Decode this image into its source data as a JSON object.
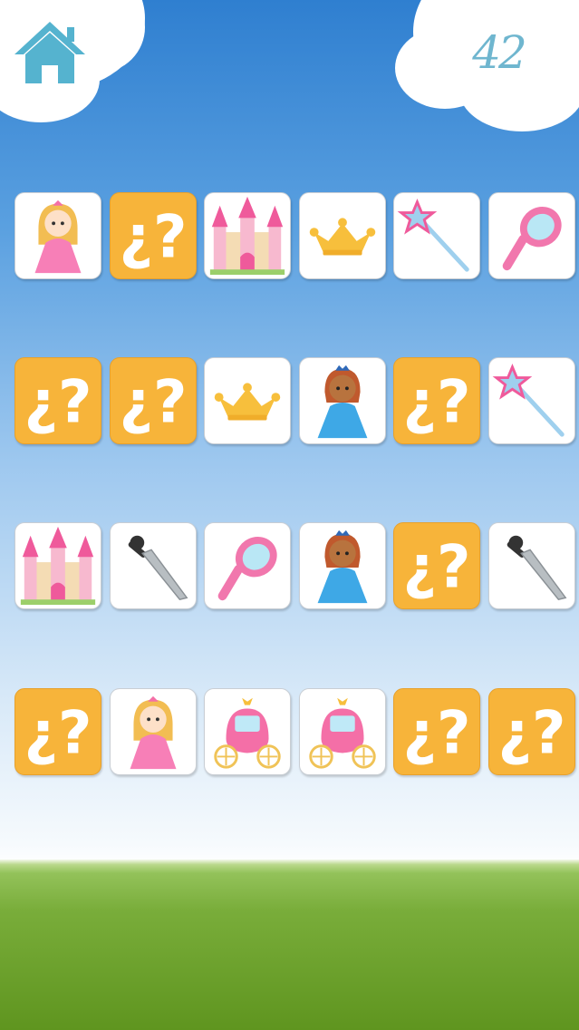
{
  "header": {
    "home_icon": "house-icon",
    "score": "42"
  },
  "colors": {
    "sky_top": "#2f7fd0",
    "card_back": "#f7b43a",
    "card_face": "#ffffff",
    "home_icon": "#55b3cf",
    "score_text": "#6fb6cf",
    "grass": "#79ad3a"
  },
  "board": {
    "columns": 6,
    "rows": [
      [
        "princess-blonde",
        "hidden",
        "castle",
        "crown",
        "wand",
        "mirror"
      ],
      [
        "hidden",
        "hidden",
        "crown",
        "princess-brunette",
        "hidden",
        "wand"
      ],
      [
        "castle",
        "sword",
        "mirror",
        "princess-brunette",
        "hidden",
        "sword"
      ],
      [
        "hidden",
        "princess-blonde",
        "carriage",
        "carriage",
        "hidden",
        "hidden"
      ]
    ]
  }
}
